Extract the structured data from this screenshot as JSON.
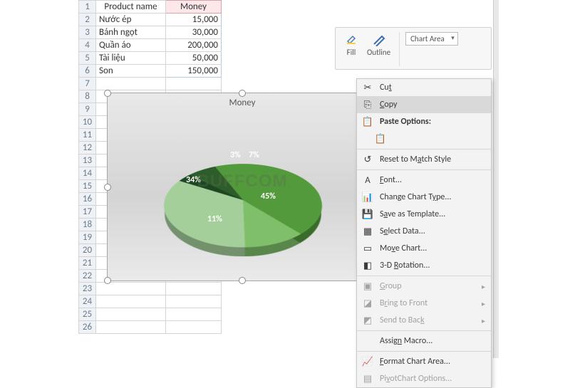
{
  "spreadsheet": {
    "headers": {
      "colA": "Product name",
      "colB": "Money"
    },
    "rows": [
      {
        "name": "Nước ép",
        "money": "15,000"
      },
      {
        "name": "Bánh ngọt",
        "money": "30,000"
      },
      {
        "name": "Quần áo",
        "money": "200,000"
      },
      {
        "name": "Tài liệu",
        "money": "50,000"
      },
      {
        "name": "Son",
        "money": "150,000"
      }
    ]
  },
  "chart_data": {
    "type": "pie",
    "title": "Money",
    "categories": [
      "Nước ép",
      "Bánh ngọt",
      "Quần áo",
      "Tài liệu",
      "Son"
    ],
    "values": [
      15000,
      30000,
      200000,
      50000,
      150000
    ],
    "percent_labels": [
      "3%",
      "7%",
      "45%",
      "11%",
      "34%"
    ],
    "colors": [
      "#1e4620",
      "#2d5d2a",
      "#529a3c",
      "#7fbf6a",
      "#a4cf9a"
    ]
  },
  "watermark": "BUFFCOM",
  "format_toolbar": {
    "fill_label": "Fill",
    "outline_label": "Outline",
    "element_selector": "Chart Area"
  },
  "context_menu": {
    "items": [
      {
        "key": "cut",
        "label_html": "Cu<u>t</u>",
        "icon": "cut-icon",
        "enabled": true
      },
      {
        "key": "copy",
        "label_html": "<u>C</u>opy",
        "icon": "copy-icon",
        "enabled": true,
        "hover": true
      },
      {
        "key": "paste_hdr",
        "label_html": "<b>Paste Options:</b>",
        "icon": "paste-icon",
        "enabled": true,
        "header": true
      },
      {
        "key": "paste_opt",
        "label_html": "",
        "icon": "clipboard-icon",
        "enabled": true,
        "indent": true
      },
      {
        "sep": true
      },
      {
        "key": "reset",
        "label_html": "Reset to M<u>a</u>tch Style",
        "icon": "reset-icon",
        "enabled": true
      },
      {
        "sep": true
      },
      {
        "key": "font",
        "label_html": "<u>F</u>ont...",
        "icon": "font-icon",
        "enabled": true
      },
      {
        "key": "changetype",
        "label_html": "Change Chart T<u>y</u>pe...",
        "icon": "chart-type-icon",
        "enabled": true
      },
      {
        "key": "savetmpl",
        "label_html": "S<u>a</u>ve as Template...",
        "icon": "save-template-icon",
        "enabled": true
      },
      {
        "key": "selectdata",
        "label_html": "S<u>e</u>lect Data...",
        "icon": "select-data-icon",
        "enabled": true
      },
      {
        "key": "movechart",
        "label_html": "Mo<u>v</u>e Chart...",
        "icon": "move-chart-icon",
        "enabled": true
      },
      {
        "key": "rot3d",
        "label_html": "3-D <u>R</u>otation...",
        "icon": "rotation-icon",
        "enabled": true
      },
      {
        "sep": true
      },
      {
        "key": "group",
        "label_html": "<u>G</u>roup",
        "icon": "group-icon",
        "enabled": false,
        "arrow": true
      },
      {
        "key": "front",
        "label_html": "B<u>r</u>ing to Front",
        "icon": "bring-front-icon",
        "enabled": false,
        "arrow": true
      },
      {
        "key": "back",
        "label_html": "Send to Bac<u>k</u>",
        "icon": "send-back-icon",
        "enabled": false,
        "arrow": true
      },
      {
        "sep": true
      },
      {
        "key": "macro",
        "label_html": "Assig<u>n</u> Macro...",
        "icon": "",
        "enabled": true
      },
      {
        "sep": true
      },
      {
        "key": "fmtarea",
        "label_html": "<u>F</u>ormat Chart Area...",
        "icon": "format-area-icon",
        "enabled": true
      },
      {
        "key": "pivotopt",
        "label_html": "Pi<u>v</u>otChart Options...",
        "icon": "pivot-icon",
        "enabled": false
      }
    ]
  }
}
